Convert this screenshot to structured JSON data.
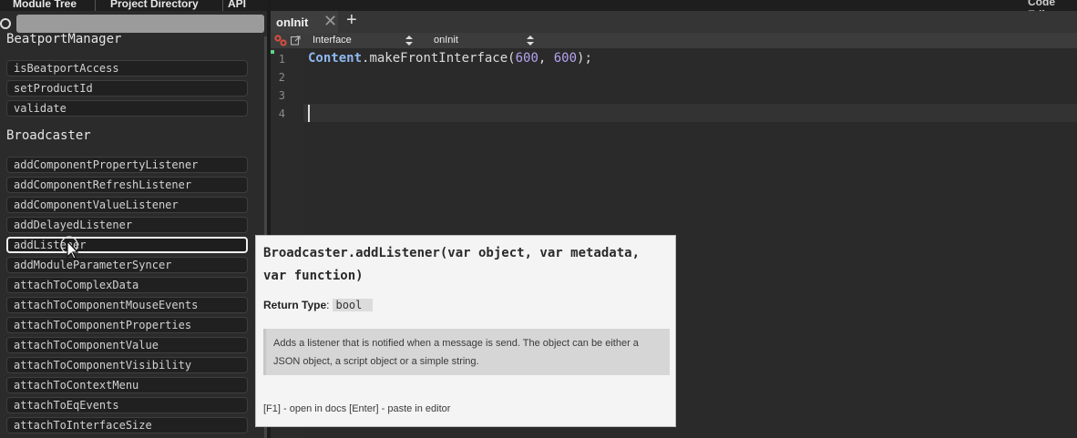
{
  "left_panel": {
    "tabs": [
      "Module Tree",
      "Project Directory",
      "API"
    ],
    "search": {
      "value": "",
      "placeholder": ""
    },
    "sections": [
      {
        "title": "BeatportManager",
        "items": [
          "isBeatportAccess",
          "setProductId",
          "validate"
        ]
      },
      {
        "title": "Broadcaster",
        "items": [
          "addComponentPropertyListener",
          "addComponentRefreshListener",
          "addComponentValueListener",
          "addDelayedListener",
          "addListener",
          "addModuleParameterSyncer",
          "attachToComplexData",
          "attachToComponentMouseEvents",
          "attachToComponentProperties",
          "attachToComponentValue",
          "attachToComponentVisibility",
          "attachToContextMenu",
          "attachToEqEvents",
          "attachToInterfaceSize"
        ]
      }
    ],
    "selected_item": "addListener"
  },
  "editor": {
    "title": "Code Editor",
    "tab": {
      "label": "onInit",
      "close": "✕",
      "add": "+"
    },
    "toolbar": {
      "interface_select": "Interface",
      "callback_select": "onInit"
    },
    "line_numbers": [
      "1",
      "2",
      "3",
      "4"
    ],
    "code": {
      "object": "Content",
      "method": ".makeFrontInterface(",
      "arg1": "600",
      "sep": ", ",
      "arg2": "600",
      "tail": ");"
    }
  },
  "tooltip": {
    "signature": "Broadcaster.addListener(var object, var metadata, var function)",
    "return_label": "Return Type",
    "return_sep": ":",
    "return_type": "bool",
    "description": "Adds a listener that is notified when a message is send. The object can be either a JSON object, a script object or a simple string.",
    "help": "[F1]  - open in docs [Enter] - paste in editor"
  },
  "colors": {
    "accent_keyword": "#8fb8f0",
    "number": "#b6a3f0",
    "gutter_marker": "#5fd38b"
  },
  "icons": [
    "search-icon",
    "link-icon",
    "popout-icon",
    "close-icon",
    "plus-icon",
    "dropdown-arrow-icon",
    "mouse-cursor-icon"
  ]
}
